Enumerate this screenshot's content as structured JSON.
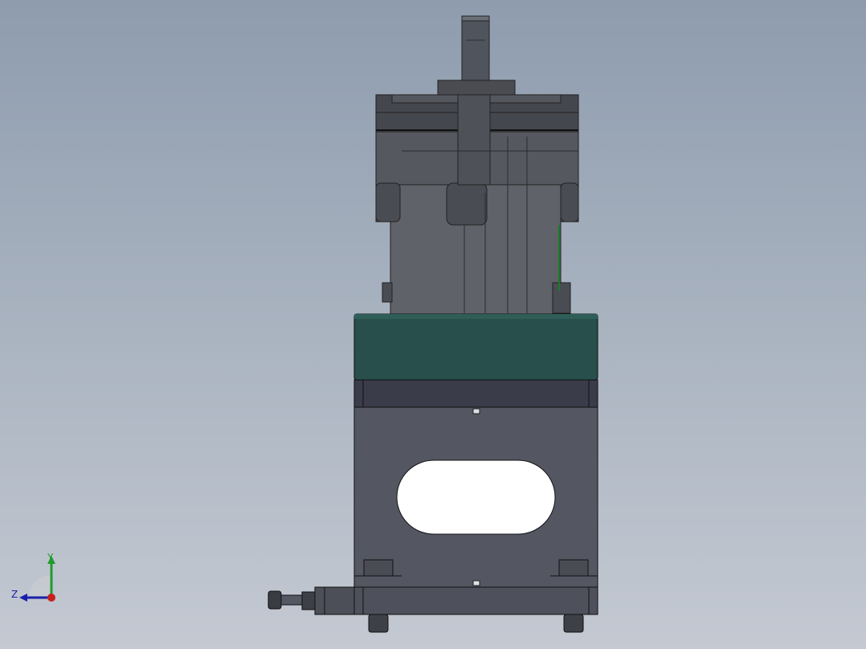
{
  "viewport": {
    "background_top": "#8e9cae",
    "background_bottom": "#c4c9d2"
  },
  "model": {
    "motor_color": "#5a5c64",
    "motor_dark": "#3d3f46",
    "flange_color": "#2c5550",
    "bracket_color": "#545762",
    "base_color": "#4e515b"
  },
  "triad": {
    "y_label": "Y",
    "z_label": "Z",
    "y_color": "#1e9c2c",
    "z_color": "#1b1fa8",
    "x_color": "#c8201e"
  }
}
